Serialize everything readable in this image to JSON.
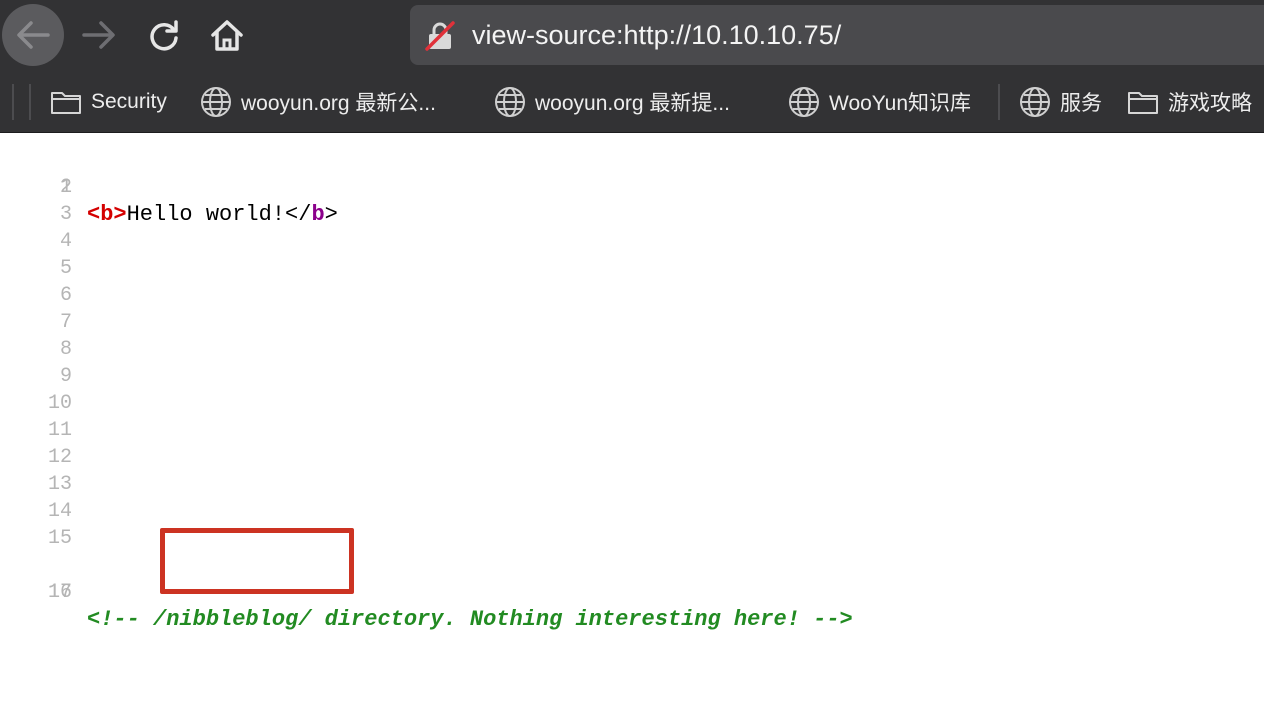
{
  "toolbar": {
    "back_icon": "arrow-left-icon",
    "forward_icon": "arrow-right-icon",
    "reload_icon": "reload-icon",
    "home_icon": "home-icon"
  },
  "urlbar": {
    "url": "view-source:http://10.10.10.75/",
    "security_icon": "insecure-lock-icon"
  },
  "bookmarks": [
    {
      "label": "Security",
      "icon": "folder-icon"
    },
    {
      "label": "wooyun.org 最新公...",
      "icon": "globe-icon"
    },
    {
      "label": "wooyun.org 最新提...",
      "icon": "globe-icon"
    },
    {
      "label": "WooYun知识库",
      "icon": "globe-icon"
    },
    {
      "label": "服务",
      "icon": "globe-icon"
    },
    {
      "label": "游戏攻略",
      "icon": "folder-icon"
    }
  ],
  "source": {
    "line_numbers": [
      "1",
      "2",
      "3",
      "4",
      "5",
      "6",
      "7",
      "8",
      "9",
      "10",
      "11",
      "12",
      "13",
      "14",
      "15",
      "16",
      "17"
    ],
    "line1": {
      "open_lt": "<",
      "open_name": "b",
      "open_gt": ">",
      "text": "Hello world!",
      "close_lt": "</",
      "close_name": "b",
      "close_gt": ">"
    },
    "line16": {
      "comment": "<!-- /nibbleblog/ directory. Nothing interesting here! -->"
    }
  },
  "colors": {
    "toolbar_bg": "#323234",
    "url_bg": "#4a4a4d",
    "tag": "#d40000",
    "comment": "#228b22",
    "highlight_box": "#cc3322"
  }
}
